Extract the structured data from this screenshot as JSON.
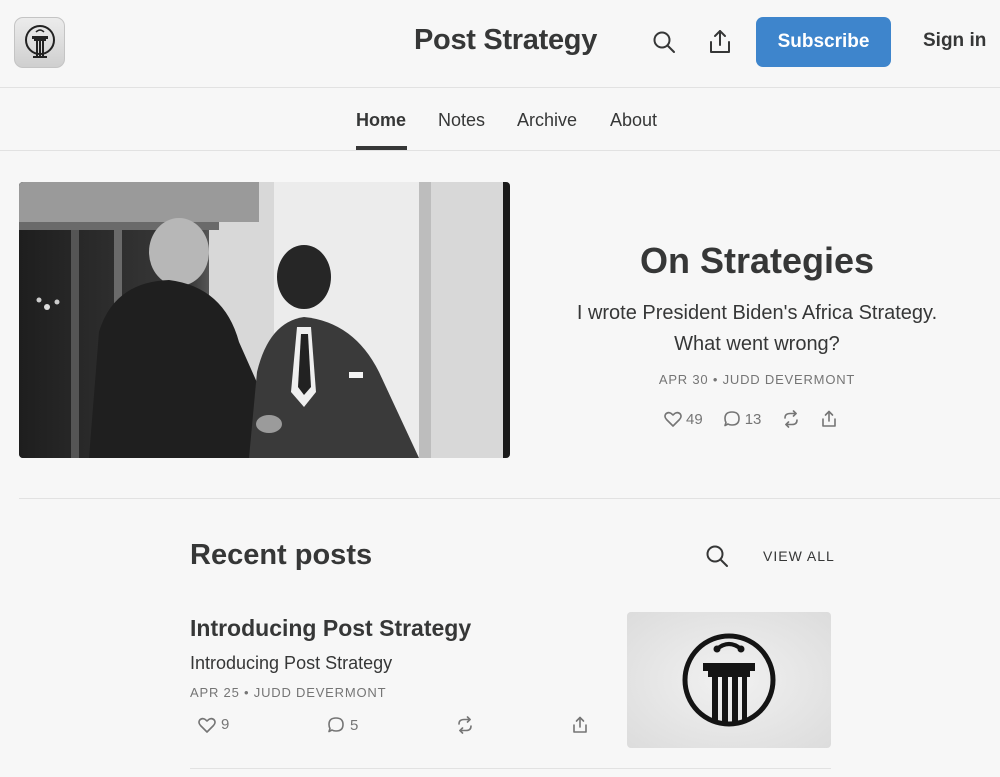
{
  "header": {
    "publication_title": "Post Strategy",
    "subscribe_label": "Subscribe",
    "signin_label": "Sign in",
    "icons": [
      "podium-logo-icon",
      "search-icon",
      "share-icon"
    ]
  },
  "nav": {
    "tabs": [
      {
        "label": "Home",
        "active": true
      },
      {
        "label": "Notes",
        "active": false
      },
      {
        "label": "Archive",
        "active": false
      },
      {
        "label": "About",
        "active": false
      }
    ]
  },
  "featured": {
    "title": "On Strategies",
    "subtitle_line1": "I wrote President Biden's Africa Strategy.",
    "subtitle_line2": "What went wrong?",
    "meta": "APR 30 • JUDD DEVERMONT",
    "likes": "49",
    "comments": "13",
    "icons": [
      "heart-icon",
      "comment-icon",
      "restack-icon",
      "share-icon"
    ]
  },
  "recent": {
    "heading": "Recent posts",
    "view_all_label": "VIEW ALL",
    "posts": [
      {
        "title": "Introducing Post Strategy",
        "subtitle": "Introducing Post Strategy",
        "meta": "APR 25 • JUDD DEVERMONT",
        "likes": "9",
        "comments": "5"
      }
    ]
  },
  "colors": {
    "accent": "#3e85cc",
    "text": "#363737",
    "muted": "#757575",
    "background": "#f7f7f7",
    "divider": "#e2e2e2"
  }
}
